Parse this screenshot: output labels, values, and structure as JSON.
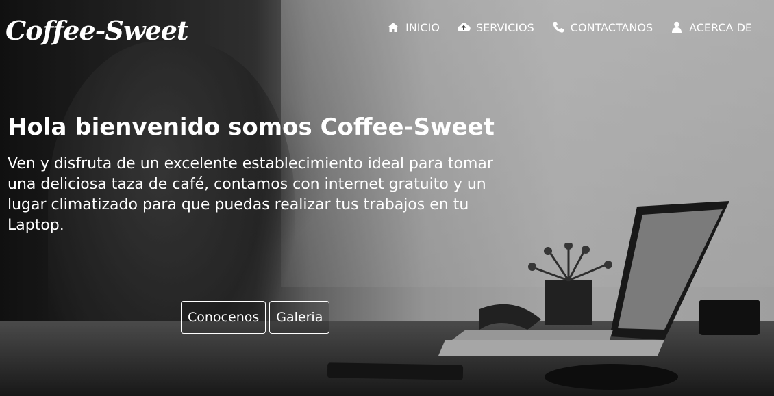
{
  "brand": {
    "logo_text": "Coffee-Sweet"
  },
  "nav": {
    "items": [
      {
        "label": "INICIO",
        "icon": "home-icon"
      },
      {
        "label": "SERVICIOS",
        "icon": "cloud-upload-icon"
      },
      {
        "label": "CONTACTANOS",
        "icon": "phone-icon"
      },
      {
        "label": "ACERCA DE",
        "icon": "user-icon"
      }
    ]
  },
  "hero": {
    "headline": "Hola bienvenido somos Coffee-Sweet",
    "description": "Ven y disfruta de un excelente establecimiento ideal para tomar una deliciosa taza de café, contamos con internet gratuito y un lugar climatizado para que puedas realizar tus trabajos en tu Laptop.",
    "buttons": [
      {
        "label": "Conocenos"
      },
      {
        "label": "Galeria"
      }
    ]
  }
}
